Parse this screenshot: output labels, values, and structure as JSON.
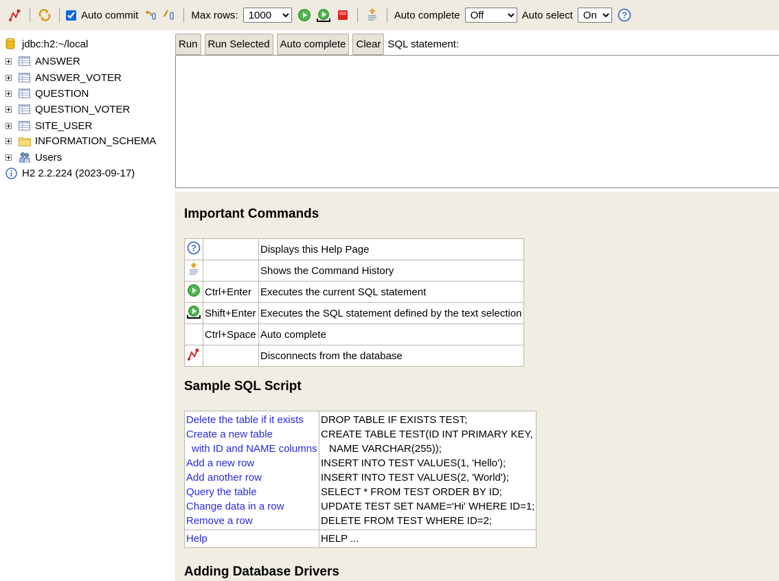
{
  "toolbar": {
    "auto_commit_label": "Auto commit",
    "auto_commit_checked": true,
    "max_rows_label": "Max rows:",
    "max_rows_value": "1000",
    "auto_complete_label": "Auto complete",
    "auto_complete_value": "Off",
    "auto_select_label": "Auto select",
    "auto_select_value": "On"
  },
  "tree": {
    "connection": "jdbc:h2:~/local",
    "tables": [
      "ANSWER",
      "ANSWER_VOTER",
      "QUESTION",
      "QUESTION_VOTER",
      "SITE_USER"
    ],
    "schema": "INFORMATION_SCHEMA",
    "users": "Users",
    "version": "H2 2.2.224 (2023-09-17)"
  },
  "query": {
    "run_label": "Run",
    "run_selected_label": "Run Selected",
    "auto_complete_label": "Auto complete",
    "clear_label": "Clear",
    "sql_statement_label": "SQL statement:"
  },
  "help": {
    "important_title": "Important Commands",
    "commands": [
      {
        "icon": "help-icon",
        "key": "",
        "desc": "Displays this Help Page"
      },
      {
        "icon": "history-icon",
        "key": "",
        "desc": "Shows the Command History"
      },
      {
        "icon": "run-icon",
        "key": "Ctrl+Enter",
        "desc": "Executes the current SQL statement"
      },
      {
        "icon": "run-selected-icon",
        "key": "Shift+Enter",
        "desc": "Executes the SQL statement defined by the text selection"
      },
      {
        "icon": "",
        "key": "Ctrl+Space",
        "desc": "Auto complete"
      },
      {
        "icon": "disconnect-icon",
        "key": "",
        "desc": "Disconnects from the database"
      }
    ],
    "sample_title": "Sample SQL Script",
    "sample": {
      "links": [
        "Delete the table if it exists",
        "Create a new table",
        "with ID and NAME columns",
        "Add a new row",
        "Add another row",
        "Query the table",
        "Change data in a row",
        "Remove a row"
      ],
      "code": [
        "DROP TABLE IF EXISTS TEST;",
        "CREATE TABLE TEST(ID INT PRIMARY KEY,",
        "NAME VARCHAR(255));",
        "INSERT INTO TEST VALUES(1, 'Hello');",
        "INSERT INTO TEST VALUES(2, 'World');",
        "SELECT * FROM TEST ORDER BY ID;",
        "UPDATE TEST SET NAME='Hi' WHERE ID=1;",
        "DELETE FROM TEST WHERE ID=2;"
      ],
      "help_link": "Help",
      "help_code": "HELP ..."
    },
    "drivers_title": "Adding Database Drivers"
  }
}
